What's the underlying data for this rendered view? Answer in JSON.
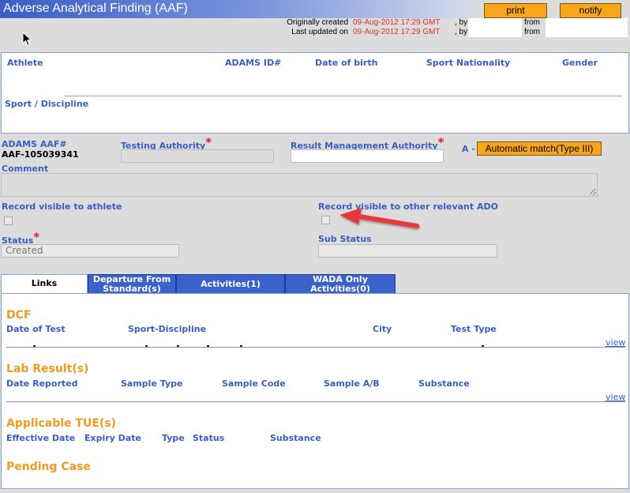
{
  "header": {
    "title": "Adverse Analytical Finding (AAF)",
    "print_label": "print",
    "notify_label": "notify",
    "created_label": "Originally created",
    "created_date": "09-Aug-2012 17:29 GMT",
    "created_by": ", by",
    "created_from": "from",
    "updated_label": "Last updated on",
    "updated_date": "09-Aug-2012 17:29 GMT",
    "updated_by": ", by",
    "updated_from": "from"
  },
  "athlete": {
    "athlete_label": "Athlete",
    "adams_id_label": "ADAMS ID#",
    "dob_label": "Date of birth",
    "nationality_label": "Sport Nationality",
    "gender_label": "Gender",
    "sport_label": "Sport / Discipline"
  },
  "form": {
    "aaf_label": "ADAMS AAF#",
    "aaf_value": "AAF-105039341",
    "testing_authority_label": "Testing Authority",
    "rma_label": "Result Management Authority",
    "a_label": "A -",
    "auto_match_label": "Automatic match(Type III)",
    "comment_label": "Comment",
    "visible_athlete_label": "Record visible to athlete",
    "visible_ado_label": "Record visible to other relevant ADO",
    "status_label": "Status",
    "status_value": "Created",
    "substatus_label": "Sub Status",
    "required_mark": "*"
  },
  "tabs": [
    {
      "label": "Links"
    },
    {
      "label": "Departure From Standard(s)"
    },
    {
      "label": "Activities(1)"
    },
    {
      "label": "WADA Only Activities(0)"
    }
  ],
  "links": {
    "dcf": {
      "title": "DCF",
      "columns": [
        "Date of Test",
        "Sport-Discipline",
        "City",
        "Test Type"
      ],
      "view_label": "view"
    },
    "lab": {
      "title": "Lab Result(s)",
      "columns": [
        "Date Reported",
        "Sample Type",
        "Sample Code",
        "Sample A/B",
        "Substance"
      ],
      "view_label": "view"
    },
    "tue": {
      "title": "Applicable TUE(s)",
      "columns": [
        "Effective Date",
        "Expiry Date",
        "Type",
        "Status",
        "Substance"
      ]
    },
    "pending": {
      "title": "Pending Case"
    }
  },
  "colors": {
    "accent_blue": "#3a5fc4",
    "orange_button": "#f7a51c",
    "section_orange": "#f39a1e",
    "date_red": "#d9362a",
    "arrow_red": "#e8393a"
  }
}
